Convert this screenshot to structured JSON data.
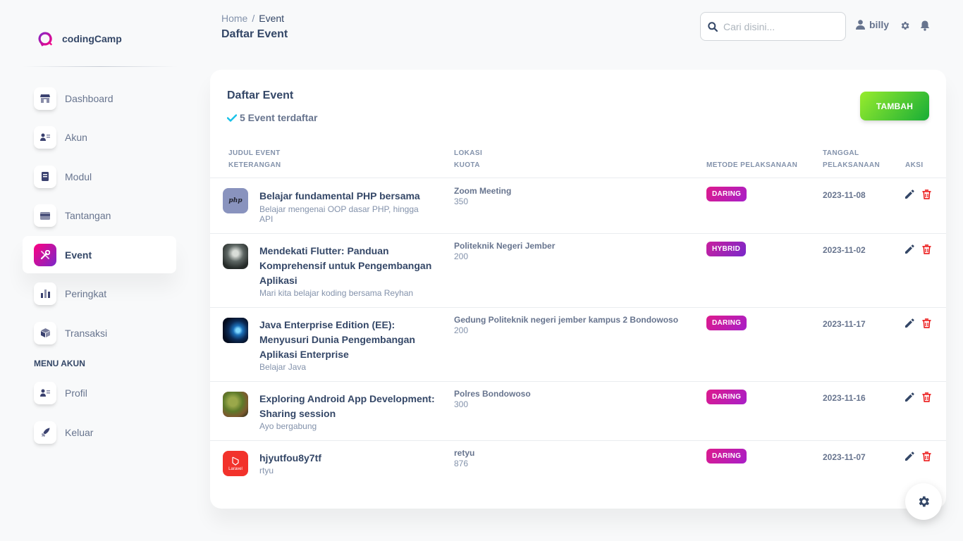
{
  "brand": {
    "name": "codingCamp",
    "logo_icon": "q-logo-icon",
    "accent": "#cb0c9f"
  },
  "sidebar": {
    "items": [
      {
        "label": "Dashboard",
        "icon": "shop-icon"
      },
      {
        "label": "Akun",
        "icon": "users-icon"
      },
      {
        "label": "Modul",
        "icon": "book-icon"
      },
      {
        "label": "Tantangan",
        "icon": "card-icon"
      },
      {
        "label": "Event",
        "icon": "tools-icon",
        "active": true
      },
      {
        "label": "Peringkat",
        "icon": "chart-icon"
      },
      {
        "label": "Transaksi",
        "icon": "box-icon"
      }
    ],
    "section_title": "MENU AKUN",
    "account_items": [
      {
        "label": "Profil",
        "icon": "users-icon"
      },
      {
        "label": "Keluar",
        "icon": "rocket-icon"
      }
    ]
  },
  "header": {
    "breadcrumb_home": "Home",
    "breadcrumb_sep": "/",
    "breadcrumb_current": "Event",
    "page_title": "Daftar Event",
    "search_placeholder": "Cari disini...",
    "username": "billy"
  },
  "card": {
    "title": "Daftar Event",
    "subtitle": "5 Event terdaftar",
    "add_button": "TAMBAH",
    "columns": {
      "judul": "JUDUL EVENT",
      "keterangan": "KETERANGAN",
      "lokasi": "LOKASI",
      "kuota": "KUOTA",
      "metode": "METODE PELAKSANAAN",
      "tanggal1": "TANGGAL",
      "tanggal2": "PELAKSANAAN",
      "aksi": "AKSI"
    },
    "rows": [
      {
        "title": "Belajar fundamental PHP bersama",
        "desc": "Belajar mengenai OOP dasar PHP, hingga API",
        "location": "Zoom Meeting",
        "quota": "350",
        "method": "DARING",
        "date": "2023-11-08",
        "thumb": "php-thumbnail"
      },
      {
        "title": "Mendekati Flutter: Panduan Komprehensif untuk Pengembangan Aplikasi",
        "desc": "Mari kita belajar koding bersama Reyhan",
        "location": "Politeknik Negeri Jember",
        "quota": "200",
        "method": "HYBRID",
        "date": "2023-11-02",
        "thumb": "speaker-thumbnail"
      },
      {
        "title": "Java Enterprise Edition (EE): Menyusuri Dunia Pengembangan Aplikasi Enterprise",
        "desc": "Belajar Java",
        "location": "Gedung Politeknik negeri jember kampus 2 Bondowoso",
        "quota": "200",
        "method": "DARING",
        "date": "2023-11-17",
        "thumb": "tech-thumbnail"
      },
      {
        "title": "Exploring Android App Development: Sharing session",
        "desc": "Ayo bergabung",
        "location": "Polres Bondowoso",
        "quota": "300",
        "method": "DARING",
        "date": "2023-11-16",
        "thumb": "nature-thumbnail"
      },
      {
        "title": "hjyutfou8y7tf",
        "desc": "rtyu",
        "location": "retyu",
        "quota": "876",
        "method": "DARING",
        "date": "2023-11-07",
        "thumb": "laravel-thumbnail"
      }
    ]
  },
  "thumb_text": {
    "php": "php",
    "laravel": "Laravel"
  },
  "colors": {
    "text_dark": "#344767",
    "text_muted": "#8392ab",
    "success": "#82d616",
    "danger": "#ea0606",
    "info": "#17c1e8"
  }
}
